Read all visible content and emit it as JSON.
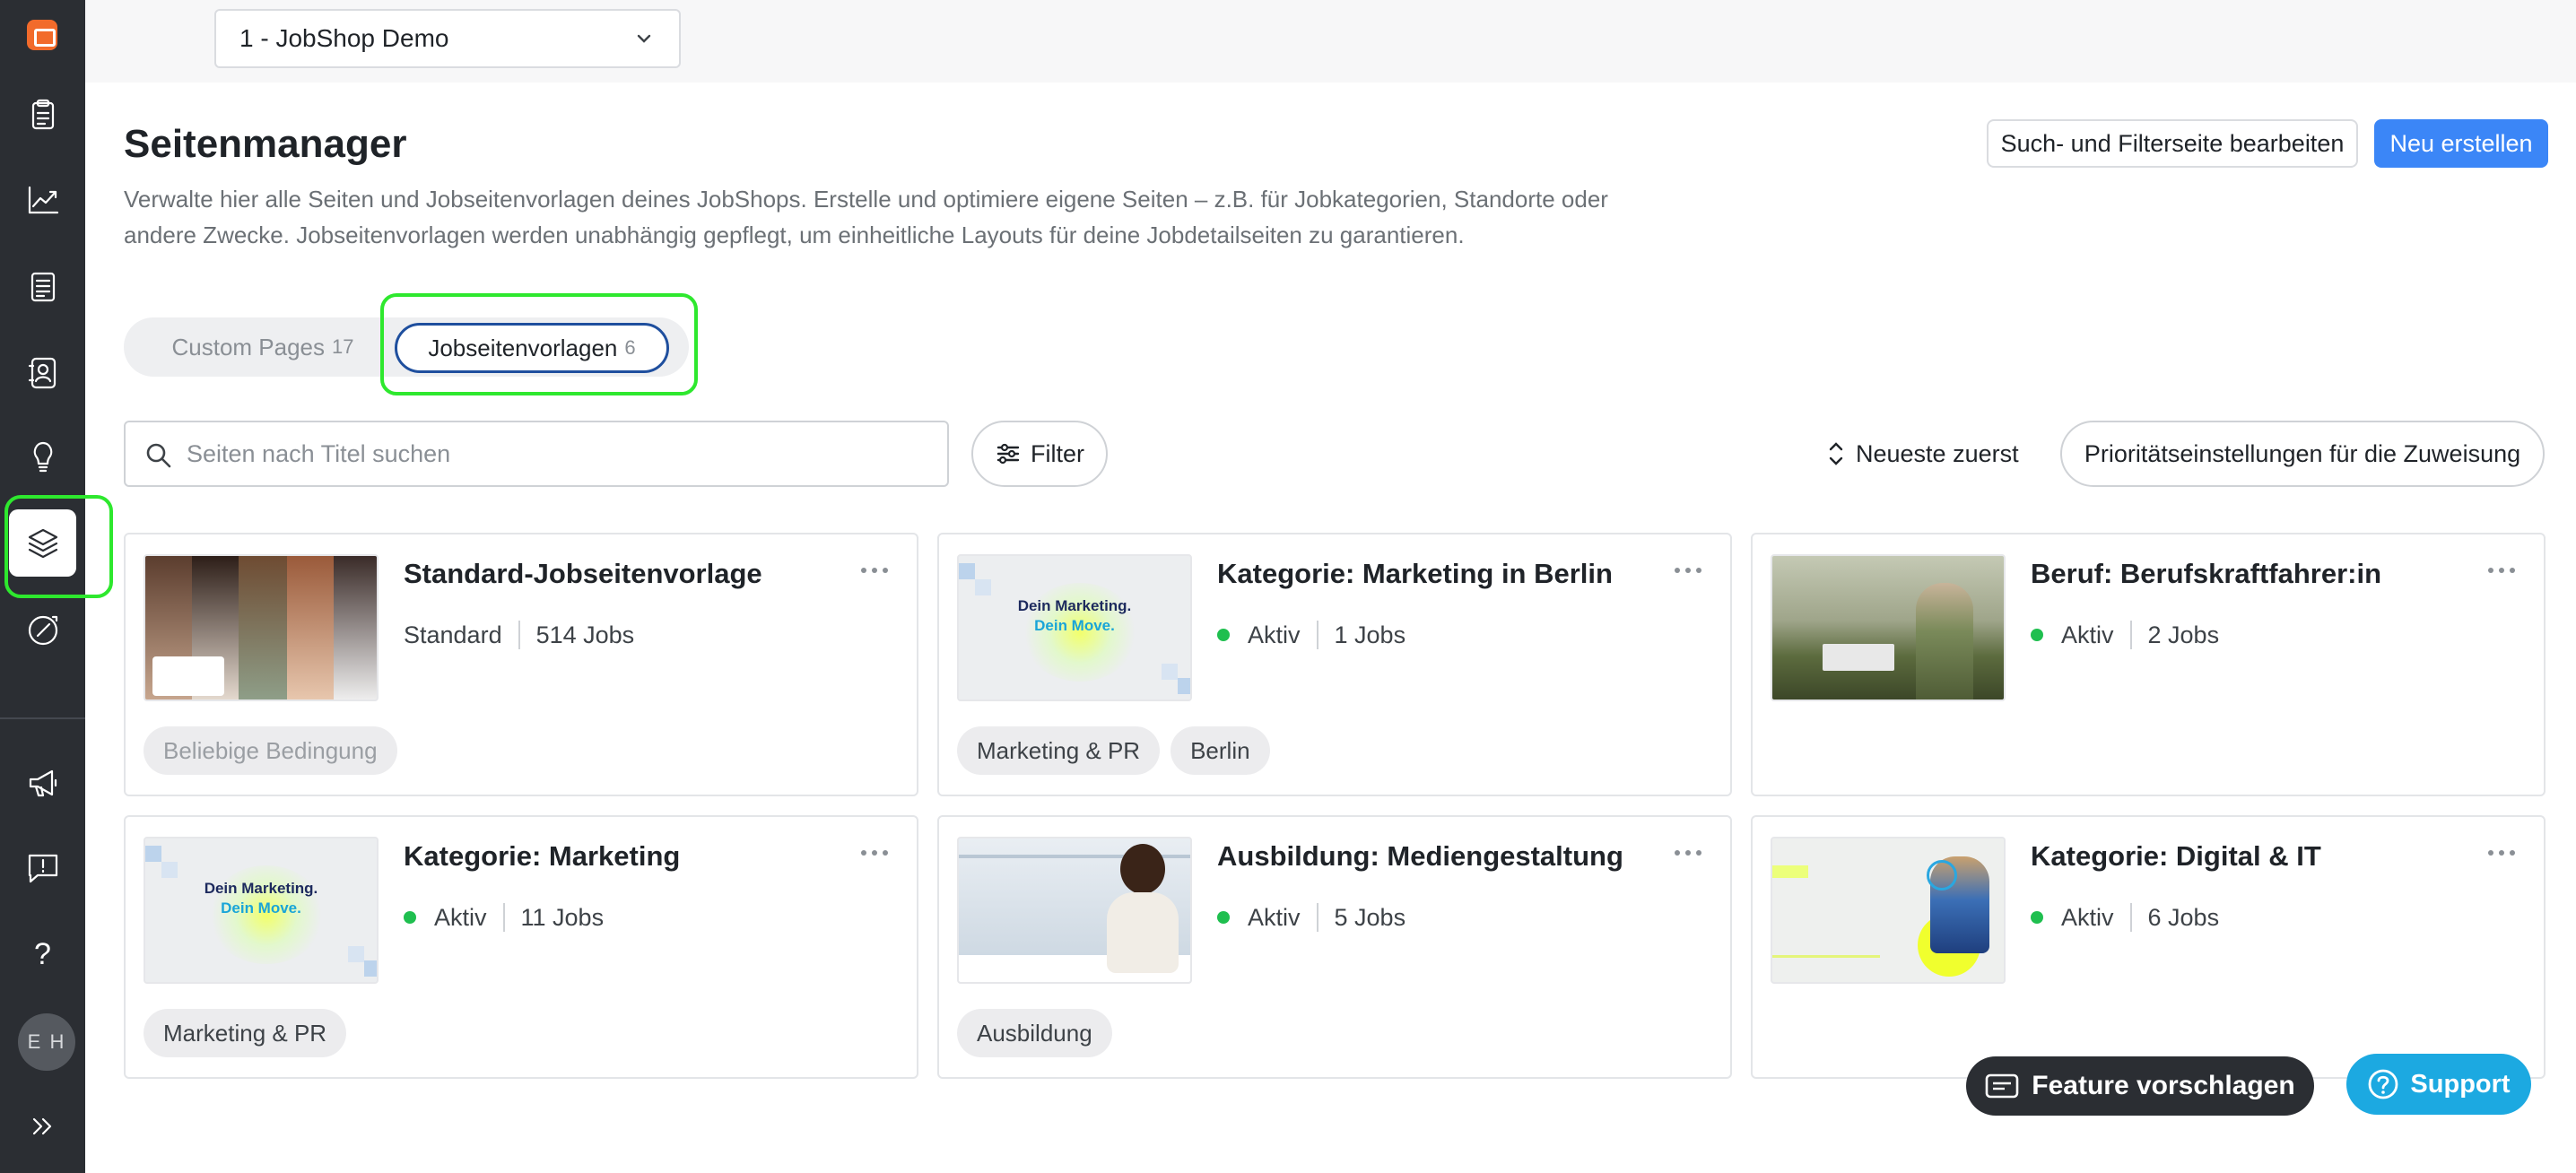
{
  "sidebar": {
    "items": [
      {
        "name": "clipboard-icon"
      },
      {
        "name": "analytics-icon"
      },
      {
        "name": "document-icon"
      },
      {
        "name": "contacts-icon"
      },
      {
        "name": "lightbulb-icon"
      },
      {
        "name": "layers-icon",
        "active": true
      },
      {
        "name": "compass-icon"
      },
      {
        "name": "megaphone-icon"
      },
      {
        "name": "feedback-icon"
      },
      {
        "name": "help-icon"
      }
    ],
    "help_label": "?",
    "avatar_initials": "E H",
    "expand_label": "»"
  },
  "header": {
    "shop_selector": "1 - JobShop Demo"
  },
  "page": {
    "title": "Seitenmanager",
    "description": "Verwalte hier alle Seiten und Jobseitenvorlagen deines JobShops. Erstelle und optimiere eigene Seiten – z.B. für Jobkategorien, Standorte oder andere Zwecke. Jobseitenvorlagen werden unabhängig gepflegt, um einheitliche Layouts für deine Jobdetailseiten zu garantieren.",
    "edit_search_button": "Such- und Filterseite bearbeiten",
    "create_button": "Neu erstellen"
  },
  "tabs": [
    {
      "label": "Custom Pages",
      "count": "17",
      "active": false
    },
    {
      "label": "Jobseitenvorlagen",
      "count": "6",
      "active": true
    }
  ],
  "toolbar": {
    "search_placeholder": "Seiten nach Titel suchen",
    "filter_label": "Filter",
    "sort_label": "Neueste zuerst",
    "priority_button": "Prioritätseinstellungen für die Zuweisung"
  },
  "cards": [
    {
      "title": "Standard-Jobseitenvorlage",
      "status": "Standard",
      "jobs": "514 Jobs",
      "chips": [
        "Beliebige Bedingung"
      ],
      "thumbnail": "people-collage"
    },
    {
      "title": "Kategorie: Marketing in Berlin",
      "status": "Aktiv",
      "jobs": "1 Jobs",
      "chips": [
        "Marketing & PR",
        "Berlin"
      ],
      "thumbnail": "marketing-banner"
    },
    {
      "title": "Beruf: Berufskraftfahrer:in",
      "status": "Aktiv",
      "jobs": "2 Jobs",
      "chips": [],
      "thumbnail": "truck-driver-photo"
    },
    {
      "title": "Kategorie: Marketing",
      "status": "Aktiv",
      "jobs": "11 Jobs",
      "chips": [
        "Marketing & PR"
      ],
      "thumbnail": "marketing-banner"
    },
    {
      "title": "Ausbildung: Mediengestaltung",
      "status": "Aktiv",
      "jobs": "5 Jobs",
      "chips": [
        "Ausbildung"
      ],
      "thumbnail": "media-design-photo"
    },
    {
      "title": "Kategorie: Digital & IT",
      "status": "Aktiv",
      "jobs": "6 Jobs",
      "chips": [],
      "thumbnail": "digital-it-photo"
    }
  ],
  "marketing_thumb": {
    "line1": "Dein Marketing.",
    "line2": "Dein Move."
  },
  "floating": {
    "feature_label": "Feature vorschlagen",
    "support_label": "Support"
  },
  "colors": {
    "sidebar": "#2b2e33",
    "primary": "#3b86f7",
    "active_dot": "#1fbf4f",
    "support": "#1ca9e1",
    "highlight": "#2ee82e"
  }
}
